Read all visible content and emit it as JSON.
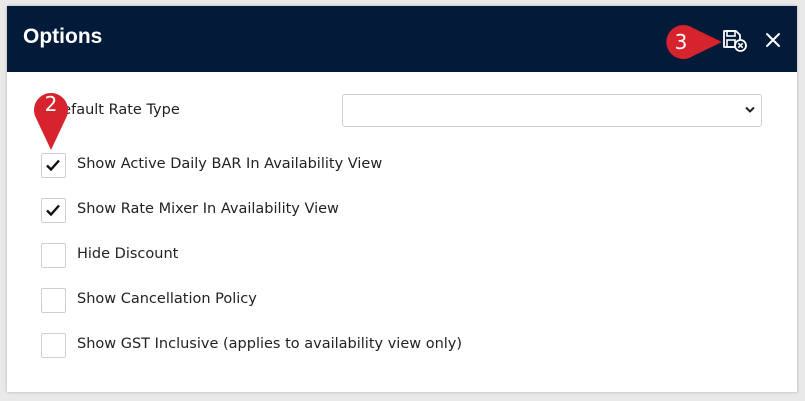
{
  "dialog": {
    "title": "Options",
    "save_icon": "save-cancel-icon",
    "close_icon": "close-icon"
  },
  "rate_type": {
    "label": "Default Rate Type",
    "selected_value": ""
  },
  "options": [
    {
      "label": "Show Active Daily BAR In Availability View",
      "checked": true
    },
    {
      "label": "Show Rate Mixer In Availability View",
      "checked": true
    },
    {
      "label": "Hide Discount",
      "checked": false
    },
    {
      "label": "Show Cancellation Policy",
      "checked": false
    },
    {
      "label": "Show GST Inclusive (applies to availability view only)",
      "checked": false
    }
  ],
  "callouts": [
    {
      "number": "2"
    },
    {
      "number": "3"
    }
  ],
  "colors": {
    "header_bg": "#031b39",
    "callout_red": "#d6232e"
  }
}
